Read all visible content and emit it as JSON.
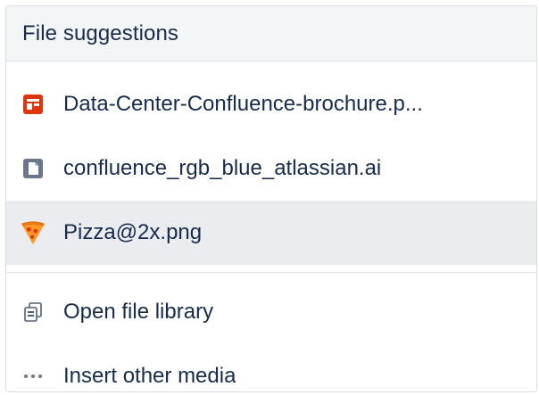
{
  "header": {
    "title": "File suggestions"
  },
  "files": [
    {
      "label": "Data-Center-Confluence-brochure.p...",
      "icon": "presentation-file-icon",
      "color": "#de350b"
    },
    {
      "label": "confluence_rgb_blue_atlassian.ai",
      "icon": "generic-file-icon",
      "color": "#6b778c"
    },
    {
      "label": "Pizza@2x.png",
      "icon": "pizza-image-icon",
      "color": "#ff991f",
      "selected": true
    }
  ],
  "actions": [
    {
      "label": "Open file library",
      "icon": "file-library-icon"
    },
    {
      "label": "Insert other media",
      "icon": "more-dots-icon"
    }
  ]
}
